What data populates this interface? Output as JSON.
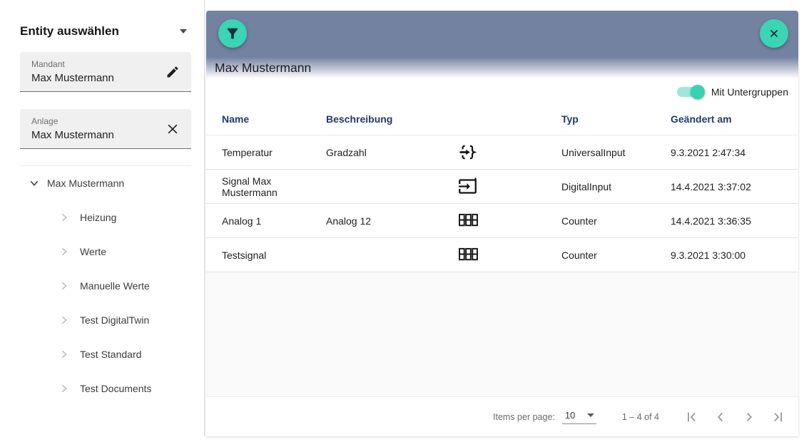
{
  "sidebar": {
    "title": "Entity auswählen",
    "collapse_icon": "caret-down-icon",
    "fields": [
      {
        "label": "Mandant",
        "value": "Max Mustermann",
        "icon": "edit-icon"
      },
      {
        "label": "Anlage",
        "value": "Max Mustermann",
        "icon": "clear-icon"
      }
    ],
    "tree": {
      "root": {
        "label": "Max Mustermann",
        "icon": "chevron-down-icon",
        "expanded": true
      },
      "children": [
        {
          "label": "Heizung",
          "icon": "chevron-right-icon"
        },
        {
          "label": "Werte",
          "icon": "chevron-right-icon"
        },
        {
          "label": "Manuelle Werte",
          "icon": "chevron-right-icon"
        },
        {
          "label": "Test DigitalTwin",
          "icon": "chevron-right-icon"
        },
        {
          "label": "Test Standard",
          "icon": "chevron-right-icon"
        },
        {
          "label": "Test Documents",
          "icon": "chevron-right-icon"
        }
      ]
    }
  },
  "main": {
    "header": {
      "title": "Max Mustermann",
      "filter_icon": "filter-icon",
      "close_icon": "close-icon"
    },
    "toggle": {
      "label": "Mit Untergruppen",
      "state": "on"
    },
    "table": {
      "headers": {
        "name": "Name",
        "beschreibung": "Beschreibung",
        "typ": "Typ",
        "geaendert_am": "Geändert am"
      },
      "rows": [
        {
          "name": "Temperatur",
          "beschreibung": "Gradzahl",
          "icon": "function-input-icon",
          "typ": "UniversalInput",
          "geaendert_am": "9.3.2021 2:47:34"
        },
        {
          "name": "Signal Max Mustermann",
          "beschreibung": "",
          "icon": "digital-input-icon",
          "typ": "DigitalInput",
          "geaendert_am": "14.4.2021 3:37:02"
        },
        {
          "name": "Analog 1",
          "beschreibung": "Analog 12",
          "icon": "counter-icon",
          "typ": "Counter",
          "geaendert_am": "14.4.2021 3:36:35"
        },
        {
          "name": "Testsignal",
          "beschreibung": "",
          "icon": "counter-icon",
          "typ": "Counter",
          "geaendert_am": "9.3.2021 3:30:00"
        }
      ]
    },
    "paginator": {
      "items_per_page_label": "Items per page:",
      "items_per_page_value": "10",
      "range_label": "1 – 4 of 4",
      "nav_icons": [
        "first-page-icon",
        "previous-page-icon",
        "next-page-icon",
        "last-page-icon"
      ]
    }
  },
  "colors": {
    "header_bar": "#7382A0",
    "accent_teal": "#3BD4B4",
    "table_header_text": "#1E3A6E",
    "icon_on_accent": "#14303C"
  }
}
